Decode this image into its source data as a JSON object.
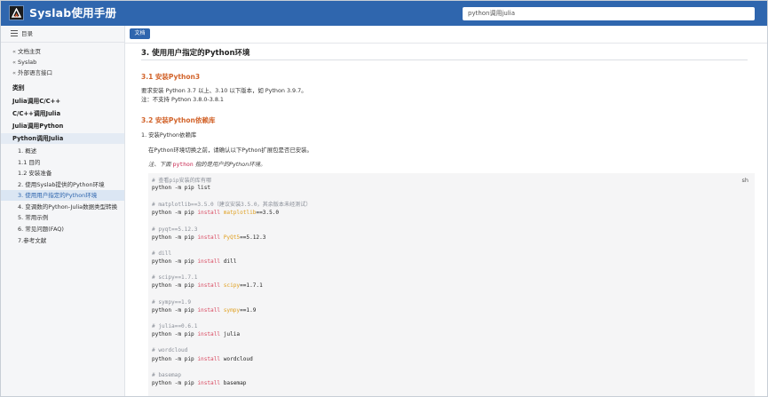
{
  "app": {
    "title": "Syslab使用手册"
  },
  "search": {
    "value": "python调用julia"
  },
  "sidebar": {
    "toc_label": "目录",
    "nav_links": [
      {
        "chevron": "«",
        "label": "文档主页"
      },
      {
        "chevron": "«",
        "label": "Syslab"
      },
      {
        "chevron": "«",
        "label": "外部语言接口"
      }
    ],
    "categories": [
      "类别",
      "Julia调用C/C++",
      "C/C++调用Julia",
      "Julia调用Python",
      "Python调用Julia"
    ],
    "sub_items": [
      "1. 概述",
      "1.1 目的",
      "1.2 安装准备",
      "2. 使用Syslab提供的Python环境",
      "3. 使用用户指定的Python环境",
      "4. 变调数的Python-Julia数据类型转换",
      "5. 常用示例",
      "6. 常见问题(FAQ)",
      "7.参考文献"
    ]
  },
  "toolbar": {
    "doc_button": "文档"
  },
  "content": {
    "h2": "3. 使用用户指定的Python环境",
    "h3_1": "3.1 安装Python3",
    "p1": "要求安装 Python 3.7 以上、3.10 以下版本，如 Python 3.9.7。",
    "p2": "注：不支持 Python 3.8.0-3.8.1",
    "h3_2": "3.2 安装Python依赖库",
    "p3": "1. 安装Python依赖库",
    "p4": "在Python环境切换之前，请确认以下Python扩展包是否已安装。",
    "note_pre": "注、下面",
    "note_code": "python",
    "note_post": "指的是用户的Python环境。",
    "code_lang": "sh",
    "code_lines": [
      [
        {
          "t": "# 查看pip安装的库有哪",
          "c": "cm"
        }
      ],
      [
        {
          "t": "python -m pip list",
          "c": "cmd"
        }
      ],
      [],
      [
        {
          "t": "# matplotlib==3.5.0（建议安装3.5.0，其余版本未经测试）",
          "c": "cm"
        }
      ],
      [
        {
          "t": "python -m pip ",
          "c": "cmd"
        },
        {
          "t": "install",
          "c": "kw"
        },
        {
          "t": " matplotlib",
          "c": "pk"
        },
        {
          "t": "==3.5.0",
          "c": "cmd"
        }
      ],
      [],
      [
        {
          "t": "# pyqt==5.12.3",
          "c": "cm"
        }
      ],
      [
        {
          "t": "python -m pip ",
          "c": "cmd"
        },
        {
          "t": "install",
          "c": "kw"
        },
        {
          "t": " PyQt5",
          "c": "pk"
        },
        {
          "t": "==5.12.3",
          "c": "cmd"
        }
      ],
      [],
      [
        {
          "t": "# dill",
          "c": "cm"
        }
      ],
      [
        {
          "t": "python -m pip ",
          "c": "cmd"
        },
        {
          "t": "install",
          "c": "kw"
        },
        {
          "t": " dill",
          "c": "cmd"
        }
      ],
      [],
      [
        {
          "t": "# scipy==1.7.1",
          "c": "cm"
        }
      ],
      [
        {
          "t": "python -m pip ",
          "c": "cmd"
        },
        {
          "t": "install",
          "c": "kw"
        },
        {
          "t": " scipy",
          "c": "pk"
        },
        {
          "t": "==1.7.1",
          "c": "cmd"
        }
      ],
      [],
      [
        {
          "t": "# sympy==1.9",
          "c": "cm"
        }
      ],
      [
        {
          "t": "python -m pip ",
          "c": "cmd"
        },
        {
          "t": "install",
          "c": "kw"
        },
        {
          "t": " sympy",
          "c": "pk"
        },
        {
          "t": "==1.9",
          "c": "cmd"
        }
      ],
      [],
      [
        {
          "t": "# julia==0.6.1",
          "c": "cm"
        }
      ],
      [
        {
          "t": "python -m pip ",
          "c": "cmd"
        },
        {
          "t": "install",
          "c": "kw"
        },
        {
          "t": " julia",
          "c": "cmd"
        }
      ],
      [],
      [
        {
          "t": "# wordcloud",
          "c": "cm"
        }
      ],
      [
        {
          "t": "python -m pip ",
          "c": "cmd"
        },
        {
          "t": "install",
          "c": "kw"
        },
        {
          "t": " wordcloud",
          "c": "cmd"
        }
      ],
      [],
      [
        {
          "t": "# basemap",
          "c": "cm"
        }
      ],
      [
        {
          "t": "python -m pip ",
          "c": "cmd"
        },
        {
          "t": "install",
          "c": "kw"
        },
        {
          "t": " basemap",
          "c": "cmd"
        }
      ]
    ]
  },
  "colors": {
    "brand": "#2f66ae",
    "heading_accent": "#d2632a",
    "keyword": "#d9485f",
    "package": "#e0a020"
  }
}
